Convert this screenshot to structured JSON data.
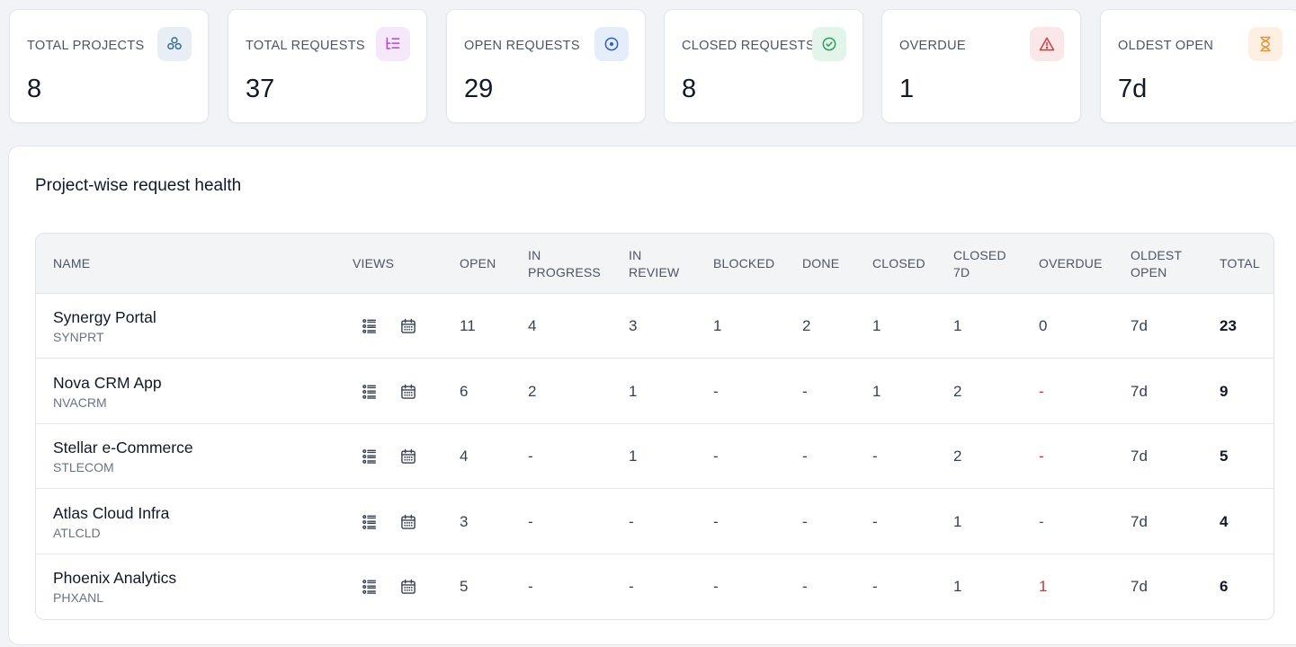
{
  "stats": [
    {
      "label": "TOTAL PROJECTS",
      "value": "8",
      "icon": "projects-icon",
      "icon_bg": "#e7eef4",
      "icon_color": "#3a6f8f"
    },
    {
      "label": "TOTAL REQUESTS",
      "value": "37",
      "icon": "list-tree-icon",
      "icon_bg": "#f6e8fb",
      "icon_color": "#b348cf"
    },
    {
      "label": "OPEN REQUESTS",
      "value": "29",
      "icon": "circle-dot-icon",
      "icon_bg": "#e6edfa",
      "icon_color": "#2f5fc4"
    },
    {
      "label": "CLOSED REQUESTS",
      "value": "8",
      "icon": "check-circle-icon",
      "icon_bg": "#e3f4ea",
      "icon_color": "#2f9a5c"
    },
    {
      "label": "OVERDUE",
      "value": "1",
      "icon": "alert-triangle-icon",
      "icon_bg": "#fbe7e8",
      "icon_color": "#d13a44"
    },
    {
      "label": "OLDEST OPEN",
      "value": "7d",
      "icon": "hourglass-icon",
      "icon_bg": "#fdf0e2",
      "icon_color": "#e39438"
    }
  ],
  "panel": {
    "title": "Project-wise request health",
    "columns": {
      "name": "NAME",
      "views": "VIEWS",
      "open": "OPEN",
      "in_progress": "IN PROGRESS",
      "in_review": "IN REVIEW",
      "blocked": "BLOCKED",
      "done": "DONE",
      "closed": "CLOSED",
      "closed_7d": "CLOSED 7D",
      "overdue": "OVERDUE",
      "oldest_open": "OLDEST OPEN",
      "total": "TOTAL"
    },
    "rows": [
      {
        "name": "Synergy Portal",
        "code": "SYNPRT",
        "open": "11",
        "in_progress": "4",
        "in_review": "3",
        "blocked": "1",
        "done": "2",
        "closed": "1",
        "closed_7d": "1",
        "overdue": "0",
        "oldest_open": "7d",
        "total": "23"
      },
      {
        "name": "Nova CRM App",
        "code": "NVACRM",
        "open": "6",
        "in_progress": "2",
        "in_review": "1",
        "blocked": "-",
        "done": "-",
        "closed": "1",
        "closed_7d": "2",
        "overdue": "-",
        "oldest_open": "7d",
        "total": "9"
      },
      {
        "name": "Stellar e-Commerce",
        "code": "STLECOM",
        "open": "4",
        "in_progress": "-",
        "in_review": "1",
        "blocked": "-",
        "done": "-",
        "closed": "-",
        "closed_7d": "2",
        "overdue": "-",
        "oldest_open": "7d",
        "total": "5"
      },
      {
        "name": "Atlas Cloud Infra",
        "code": "ATLCLD",
        "open": "3",
        "in_progress": "-",
        "in_review": "-",
        "blocked": "-",
        "done": "-",
        "closed": "-",
        "closed_7d": "1",
        "overdue": "-",
        "oldest_open": "7d",
        "total": "4"
      },
      {
        "name": "Phoenix Analytics",
        "code": "PHXANL",
        "open": "5",
        "in_progress": "-",
        "in_review": "-",
        "blocked": "-",
        "done": "-",
        "closed": "-",
        "closed_7d": "1",
        "overdue": "1",
        "oldest_open": "7d",
        "total": "6"
      }
    ],
    "overdue_color": "#c8323c"
  }
}
